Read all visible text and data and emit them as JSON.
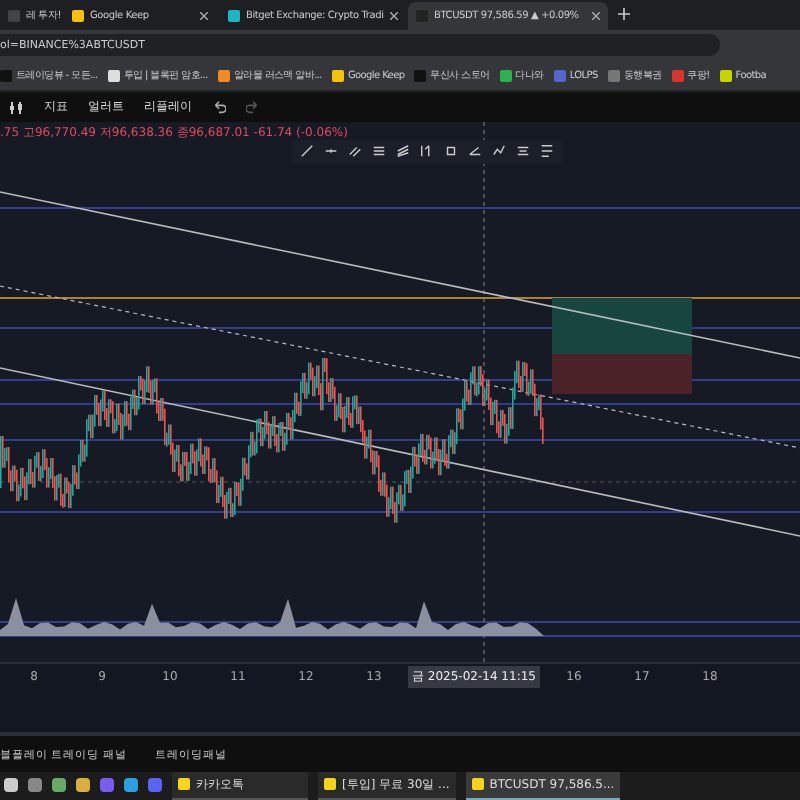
{
  "browser_tabs": [
    {
      "title": "레 투자!",
      "selected": false,
      "color": "#444444"
    },
    {
      "title": "Google Keep",
      "selected": false,
      "color": "#f4c20d"
    },
    {
      "title": "Bitget Exchange: Crypto Tradi",
      "selected": false,
      "color": "#19b8c4"
    },
    {
      "title": "BTCUSDT 97,586.59 ▲ +0.09%",
      "selected": true,
      "color": "#222222"
    }
  ],
  "address": "ol=BINANCE%3ABTCUSDT",
  "bookmarks": [
    {
      "label": "트레이딩뷰 - 모든...",
      "color": "#111111"
    },
    {
      "label": "투입 | 블록펀 암호...",
      "color": "#dddddd"
    },
    {
      "label": "알라물 러스맥 알바...",
      "color": "#f08a24"
    },
    {
      "label": "Google Keep",
      "color": "#f4c20d"
    },
    {
      "label": "무신사 스토어",
      "color": "#111111"
    },
    {
      "label": "다나와",
      "color": "#2bb24c"
    },
    {
      "label": "LOLPS",
      "color": "#5566cc"
    },
    {
      "label": "동행복권",
      "color": "#777777"
    },
    {
      "label": "쿠팡!",
      "color": "#d8342c"
    },
    {
      "label": "Footba",
      "color": "#c8d400"
    }
  ],
  "chart_toolbar": [
    "지표",
    "얼러트",
    "리플레이"
  ],
  "ohlc": ".75 고96,770.49 저96,638.36 종96,687.01 -61.74 (-0.06%)",
  "time_axis": [
    {
      "label": "8",
      "selected": false
    },
    {
      "label": "9",
      "selected": false
    },
    {
      "label": "10",
      "selected": false
    },
    {
      "label": "11",
      "selected": false
    },
    {
      "label": "12",
      "selected": false
    },
    {
      "label": "13",
      "selected": false
    },
    {
      "label": "금 2025-02-14   11:15",
      "selected": true
    },
    {
      "label": "16",
      "selected": false
    },
    {
      "label": "17",
      "selected": false
    },
    {
      "label": "18",
      "selected": false
    }
  ],
  "bottom_panel_tabs": [
    "블플레이 트레이딩 패널",
    "트레이딩패널"
  ],
  "taskbar": {
    "pinned": [
      {
        "color": "#cccccc"
      },
      {
        "color": "#888888"
      },
      {
        "color": "#66aa66"
      },
      {
        "color": "#d8b040"
      },
      {
        "color": "#7a5cf0"
      },
      {
        "color": "#2aa0e0"
      },
      {
        "color": "#5865f2"
      }
    ],
    "windows": [
      {
        "title": "카카오톡",
        "selected": false
      },
      {
        "title": "[투입] 무료 30일 ...",
        "selected": false
      },
      {
        "title": "BTCUSDT 97,586.5...",
        "selected": true
      }
    ]
  }
}
